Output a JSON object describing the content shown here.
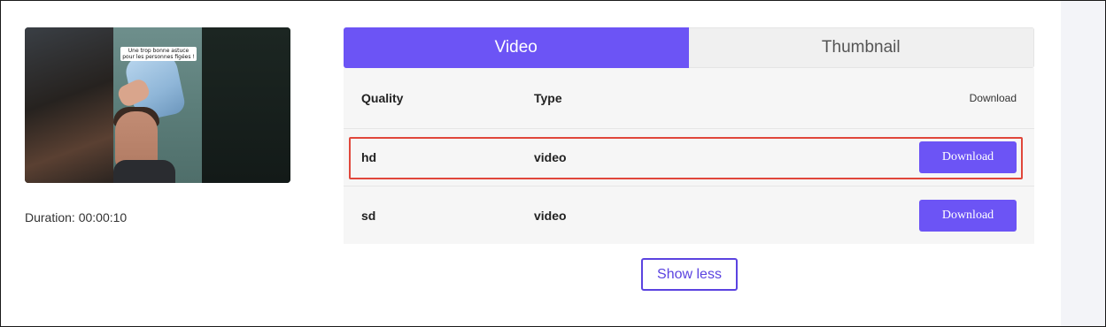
{
  "thumbnail": {
    "caption": "Une trop bonne astuce pour les personnes figées !"
  },
  "duration": "Duration: 00:00:10",
  "tabs": [
    {
      "label": "Video",
      "active": true
    },
    {
      "label": "Thumbnail",
      "active": false
    }
  ],
  "table": {
    "headers": {
      "quality": "Quality",
      "type": "Type",
      "download": "Download"
    },
    "rows": [
      {
        "quality": "hd",
        "type": "video",
        "button": "Download",
        "highlighted": true
      },
      {
        "quality": "sd",
        "type": "video",
        "button": "Download",
        "highlighted": false
      }
    ]
  },
  "show_less": "Show less",
  "colors": {
    "accent": "#6c54f5",
    "highlight": "#e0473b",
    "show_less_border": "#5b43e0"
  }
}
